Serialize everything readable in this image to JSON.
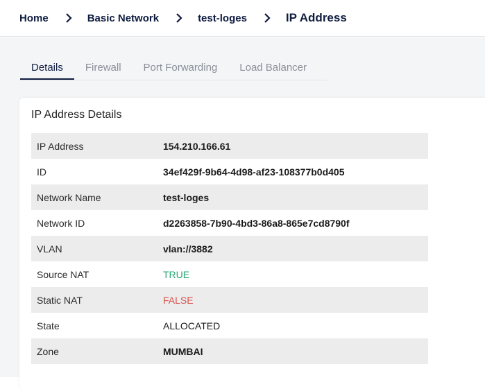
{
  "breadcrumb": {
    "items": [
      "Home",
      "Basic Network",
      "test-loges"
    ],
    "current": "IP Address"
  },
  "tabs": [
    {
      "label": "Details",
      "active": true
    },
    {
      "label": "Firewall",
      "active": false
    },
    {
      "label": "Port Forwarding",
      "active": false
    },
    {
      "label": "Load Balancer",
      "active": false
    }
  ],
  "details": {
    "title": "IP Address Details",
    "rows": [
      {
        "key": "IP Address",
        "value": "154.210.166.61"
      },
      {
        "key": "ID",
        "value": "34ef429f-9b64-4d98-af23-108377b0d405"
      },
      {
        "key": "Network Name",
        "value": "test-loges"
      },
      {
        "key": "Network ID",
        "value": "d2263858-7b90-4bd3-86a8-865e7cd8790f"
      },
      {
        "key": "VLAN",
        "value": "vlan://3882"
      },
      {
        "key": "Source NAT",
        "value": "TRUE"
      },
      {
        "key": "Static NAT",
        "value": "FALSE"
      },
      {
        "key": "State",
        "value": "ALLOCATED"
      },
      {
        "key": "Zone",
        "value": "MUMBAI"
      }
    ]
  },
  "colors": {
    "brand_navy": "#0f1c3f",
    "true_green": "#2aa876",
    "false_red": "#d8544f",
    "row_shade": "#ececec",
    "page_bg": "#f4f5f7"
  },
  "icons": {
    "breadcrumb_separator": "chevron-right-icon"
  }
}
